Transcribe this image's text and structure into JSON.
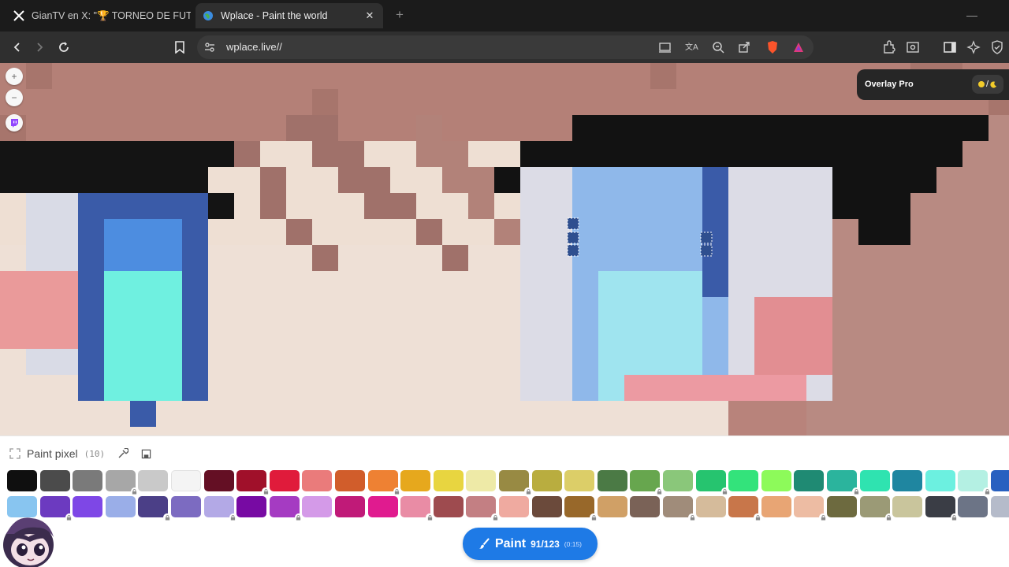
{
  "browser": {
    "tabs": [
      {
        "title": "GianTV en X: \"🏆 TORNEO DE FUTBOL",
        "active": false
      },
      {
        "title": "Wplace - Paint the world",
        "active": true
      }
    ],
    "url": "wplace.live//",
    "brand_color": "#fb542b"
  },
  "overlay": {
    "title": "Overlay Pro",
    "toggle_label": "/"
  },
  "paint_panel": {
    "title": "Paint pixel",
    "count": "(10)",
    "palette_row1": [
      "#0f0f0f",
      "#4b4b4b",
      "#7a7a7a",
      "#a7a7a7",
      "#c9c9c9",
      "#f4f4f4",
      "#640f24",
      "#a0102a",
      "#e01b3b",
      "#ea7b7b",
      "#d15d2b",
      "#ee8133",
      "#e6a81d",
      "#e8d540",
      "#eeeaa7",
      "#988a43",
      "#b9ad3f",
      "#dcce68",
      "#4b7a45",
      "#67a64e",
      "#8ac77a",
      "#26c46f",
      "#33e37b",
      "#8dfa5a",
      "#1f8a73",
      "#2bb49d",
      "#2fe3b0",
      "#1f86a0",
      "#6cf0e0",
      "#b4f0e3",
      "#2860c0"
    ],
    "palette_row2": [
      "#88c5f0",
      "#6c3ac0",
      "#7e47e6",
      "#9aaee8",
      "#4b3f87",
      "#7c6bc1",
      "#b3a9e6",
      "#770aa3",
      "#a53bc2",
      "#d49ae8",
      "#c01a78",
      "#e01b8f",
      "#e98ca5",
      "#9e4b4f",
      "#c37f83",
      "#efaaa0",
      "#6b4a3b",
      "#98682a",
      "#d0a066",
      "#7a6257",
      "#a08c7a",
      "#d5bb9b",
      "#c8764a",
      "#e8a574",
      "#edbca3",
      "#6d6a3f",
      "#9b9a76",
      "#c9c59c",
      "#3a3d45",
      "#6c7486",
      "#b5bbca"
    ],
    "locked_row1": [
      3,
      7,
      11,
      15,
      19,
      21,
      25,
      29,
      30
    ],
    "locked_row2": [
      1,
      4,
      6,
      8,
      12,
      14,
      17,
      20,
      22,
      24,
      26,
      28,
      30
    ]
  },
  "paint_button": {
    "label": "Paint",
    "count": "91/123",
    "timer": "(0:15)"
  }
}
